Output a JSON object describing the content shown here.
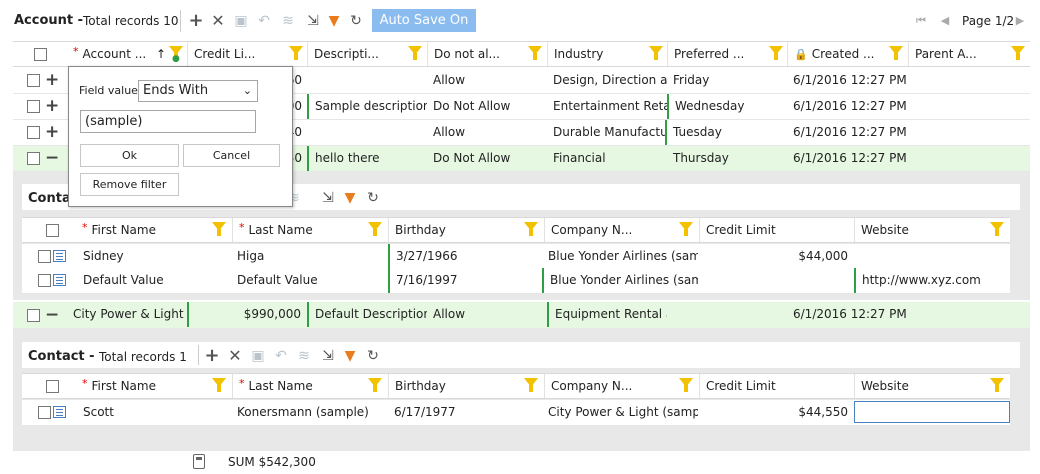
{
  "main": {
    "title": "Account -",
    "total": "Total records 10",
    "autosave": "Auto Save On",
    "page": "Page 1/2",
    "columns": [
      "Account ...",
      "Credit Li...",
      "Descripti...",
      "Do not al...",
      "Industry",
      "Preferred ...",
      "Created ...",
      "Parent A..."
    ],
    "rows": [
      {
        "credit": "60",
        "desc": "",
        "donot": "Allow",
        "industry": "Design, Direction an...",
        "preferred": "Friday",
        "created": "6/1/2016 12:27 PM"
      },
      {
        "credit": "00",
        "desc": "Sample description",
        "donot": "Do Not Allow",
        "industry": "Entertainment Retail",
        "preferred": "Wednesday",
        "created": "6/1/2016 12:27 PM"
      },
      {
        "credit": "40",
        "desc": "",
        "donot": "Allow",
        "industry": "Durable Manufactur...",
        "preferred": "Tuesday",
        "created": "6/1/2016 12:27 PM"
      },
      {
        "credit": "50",
        "desc": "hello there",
        "donot": "Do Not Allow",
        "industry": "Financial",
        "preferred": "Thursday",
        "created": "6/1/2016 12:27 PM"
      }
    ],
    "row5": {
      "account": "City Power & Light ...",
      "credit": "$990,000",
      "desc": "Default Description",
      "donot": "Allow",
      "industry": "Equipment Rental a...",
      "created": "6/1/2016 12:27 PM"
    },
    "sum": "SUM $542,300"
  },
  "contact1": {
    "title": "Conta",
    "columns": [
      "First Name",
      "Last Name",
      "Birthday",
      "Company N...",
      "Credit Limit",
      "Website"
    ],
    "rows": [
      {
        "first": "Sidney",
        "last": "Higa",
        "birthday": "3/27/1966",
        "company": "Blue Yonder Airlines (samp...",
        "credit": "$44,000",
        "website": ""
      },
      {
        "first": "Default Value",
        "last": "Default Value",
        "birthday": "7/16/1997",
        "company": "Blue Yonder Airlines (samp...",
        "credit": "",
        "website": "http://www.xyz.com"
      }
    ]
  },
  "contact2": {
    "title": "Contact -",
    "total": "Total records 1",
    "columns": [
      "First Name",
      "Last Name",
      "Birthday",
      "Company N...",
      "Credit Limit",
      "Website"
    ],
    "rows": [
      {
        "first": "Scott",
        "last": "Konersmann (sample)",
        "birthday": "6/17/1977",
        "company": "City Power & Light (sampl...",
        "credit": "$44,550",
        "website": ""
      }
    ]
  },
  "filter_popup": {
    "label": "Field value",
    "operator": "Ends With",
    "value": "(sample)",
    "ok": "Ok",
    "cancel": "Cancel",
    "remove": "Remove filter"
  }
}
